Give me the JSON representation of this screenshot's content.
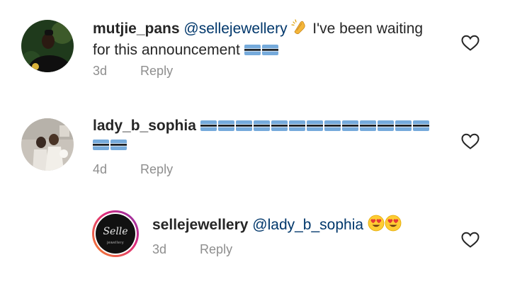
{
  "comments": [
    {
      "username": "mutjie_pans",
      "mention": "@sellejewellery",
      "text_line1": "I've been waiting",
      "text_line2": "for this announcement",
      "age": "3d",
      "reply_label": "Reply",
      "emoji": [
        "clapping-hands",
        "flag-botswana",
        "flag-botswana"
      ]
    },
    {
      "username": "lady_b_sophia",
      "text": "",
      "flag_count": 15,
      "age": "4d",
      "reply_label": "Reply",
      "emoji": [
        "flag-botswana"
      ]
    },
    {
      "username": "sellejewellery",
      "mention": "@lady_b_sophia",
      "age": "3d",
      "reply_label": "Reply",
      "emoji": [
        "smiling-face-with-heart-eyes",
        "smiling-face-with-heart-eyes"
      ],
      "avatar_logo_text": "Selle",
      "avatar_caption": "jewellery"
    }
  ],
  "colors": {
    "username": "#262626",
    "mention": "#00376b",
    "meta": "#8e8e8e",
    "story_ring_start": "#f58529",
    "story_ring_end": "#dd2a7b",
    "flag_blue": "#75aadb",
    "flag_black": "#000000"
  }
}
